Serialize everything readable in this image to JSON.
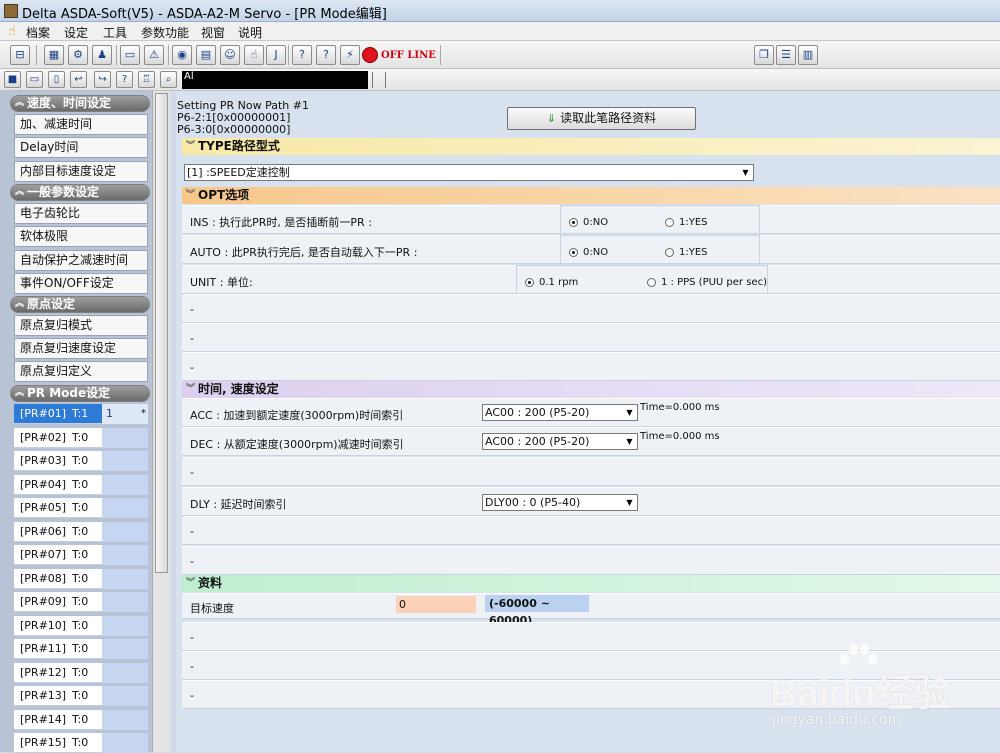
{
  "window": {
    "title": "Delta ASDA-Soft(V5) - ASDA-A2-M Servo - [PR Mode编辑]"
  },
  "menu": {
    "items": [
      "档案",
      "设定",
      "工具",
      "参数功能",
      "视窗",
      "说明"
    ]
  },
  "toolbar": {
    "offline_label": "OFF LINE",
    "address_text": "Al"
  },
  "sidebar": {
    "groups": [
      {
        "title": "速度、时间设定",
        "items": [
          "加、减速时间",
          "Delay时间",
          "内部目标速度设定"
        ]
      },
      {
        "title": "一般参数设定",
        "items": [
          "电子齿轮比",
          "软体极限",
          "自动保护之减速时间",
          "事件ON/OFF设定"
        ]
      },
      {
        "title": "原点设定",
        "items": [
          "原点复归模式",
          "原点复归速度设定",
          "原点复归定义"
        ]
      },
      {
        "title": "PR Mode设定",
        "items": []
      }
    ],
    "pr_list": [
      {
        "name": "[PR#01]",
        "t": "T:1",
        "mark": "1",
        "star": "*"
      },
      {
        "name": "[PR#02]",
        "t": "T:0"
      },
      {
        "name": "[PR#03]",
        "t": "T:0"
      },
      {
        "name": "[PR#04]",
        "t": "T:0"
      },
      {
        "name": "[PR#05]",
        "t": "T:0"
      },
      {
        "name": "[PR#06]",
        "t": "T:0"
      },
      {
        "name": "[PR#07]",
        "t": "T:0"
      },
      {
        "name": "[PR#08]",
        "t": "T:0"
      },
      {
        "name": "[PR#09]",
        "t": "T:0"
      },
      {
        "name": "[PR#10]",
        "t": "T:0"
      },
      {
        "name": "[PR#11]",
        "t": "T:0"
      },
      {
        "name": "[PR#12]",
        "t": "T:0"
      },
      {
        "name": "[PR#13]",
        "t": "T:0"
      },
      {
        "name": "[PR#14]",
        "t": "T:0"
      },
      {
        "name": "[PR#15]",
        "t": "T:0"
      }
    ]
  },
  "main": {
    "header": {
      "line1": "Setting PR Now Path #1",
      "line2": "P6-2:1[0x00000001]",
      "line3": "P6-3:0[0x00000000]",
      "read_button": "读取此笔路径资料"
    },
    "type_section": {
      "title": "TYPE路径型式",
      "value": "[1] :SPEED定速控制"
    },
    "opt_section": {
      "title": "OPT选项",
      "ins_label": "INS : 执行此PR时, 是否插断前一PR :",
      "ins_options": [
        "0:NO",
        "1:YES"
      ],
      "auto_label": "AUTO : 此PR执行完后, 是否自动载入下一PR :",
      "auto_options": [
        "0:NO",
        "1:YES"
      ],
      "unit_label": "UNIT : 单位:",
      "unit_options": [
        "0.1 rpm",
        "1 : PPS (PUU per sec)"
      ],
      "dash": "-"
    },
    "time_section": {
      "title": "时间, 速度设定",
      "acc_label": "ACC : 加速到额定速度(3000rpm)时间索引",
      "acc_value": "AC00 : 200 (P5-20)",
      "acc_time": "Time=0.000 ms",
      "dec_label": "DEC : 从额定速度(3000rpm)减速时间索引",
      "dec_value": "AC00 : 200 (P5-20)",
      "dec_time": "Time=0.000 ms",
      "dly_label": "DLY : 延迟时间索引",
      "dly_value": "DLY00 : 0 (P5-40)",
      "dash": "-"
    },
    "data_section": {
      "title": "资料",
      "target_label": "目标速度",
      "target_value": "0",
      "range": "(-60000 ~ 60000)",
      "dash": "-"
    }
  },
  "watermark": {
    "brand": "Baidu经验",
    "url": "jingyan.baidu.com"
  }
}
